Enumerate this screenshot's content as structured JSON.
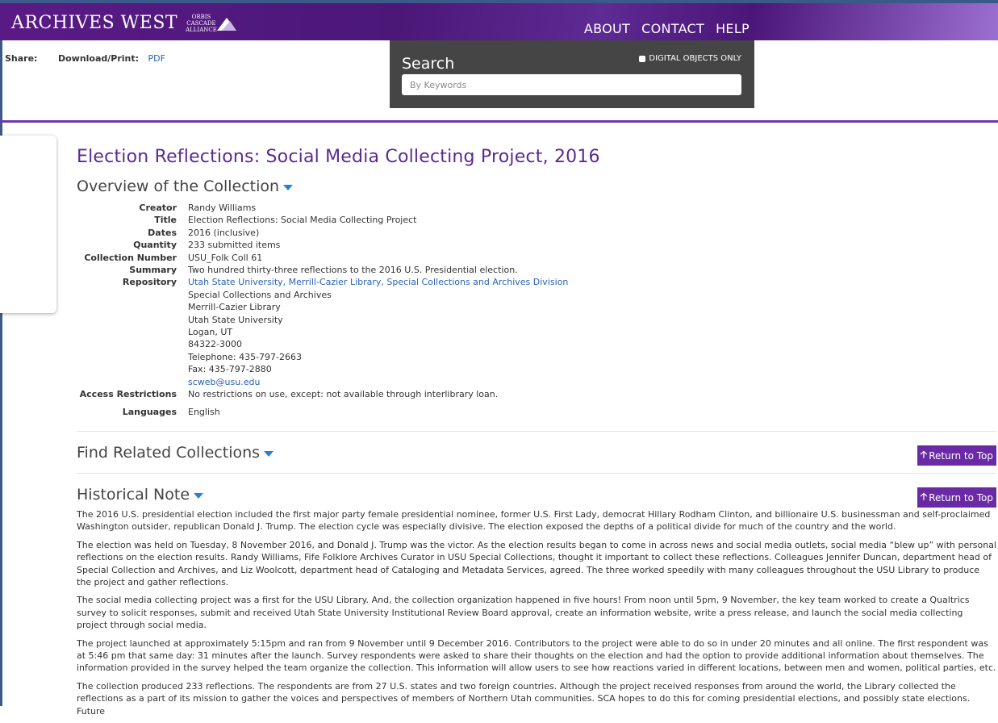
{
  "header": {
    "logo": "ARCHIVES WEST",
    "partner_logo_lines": [
      "ORBIS",
      "CASCADE",
      "ALLIANCE"
    ],
    "nav": [
      "ABOUT",
      "CONTACT",
      "HELP"
    ]
  },
  "share": {
    "share_label": "Share:",
    "download_label": "Download/Print:",
    "pdf_link": "PDF"
  },
  "search": {
    "title": "Search",
    "digital_only_label": "DIGITAL OBJECTS ONLY",
    "placeholder": "By Keywords"
  },
  "page_title": "Election Reflections: Social Media Collecting Project, 2016",
  "overview": {
    "heading": "Overview of the Collection",
    "rows": [
      {
        "key": "Creator",
        "value": "Randy Williams"
      },
      {
        "key": "Title",
        "value": "Election Reflections: Social Media Collecting Project"
      },
      {
        "key": "Dates",
        "value": "2016 (inclusive)"
      },
      {
        "key": "Quantity",
        "value": "233 submitted items"
      },
      {
        "key": "Collection Number",
        "value": "USU_Folk Coll 61"
      },
      {
        "key": "Summary",
        "value": "Two hundred thirty-three reflections to the 2016 U.S. Presidential election."
      }
    ],
    "repository_key": "Repository",
    "repository_link": "Utah State University, Merrill-Cazier Library, Special Collections and Archives Division",
    "repository_lines": [
      "Special Collections and Archives",
      "Merrill-Cazier Library",
      "Utah State University",
      "Logan, UT",
      "84322-3000",
      "Telephone: 435-797-2663",
      "Fax: 435-797-2880"
    ],
    "repository_email": "scweb@usu.edu",
    "access_key": "Access Restrictions",
    "access_value": "No restrictions on use, except: not available through interlibrary loan.",
    "languages_key": "Languages",
    "languages_value": "English"
  },
  "related": {
    "heading": "Find Related Collections",
    "return_label": "Return to Top"
  },
  "historical": {
    "heading": "Historical Note",
    "return_label": "Return to Top",
    "paragraphs": [
      "The 2016 U.S. presidential election included the first major party female presidential nominee, former U.S. First Lady, democrat Hillary Rodham Clinton, and billionaire U.S. businessman and self-proclaimed Washington outsider, republican Donald J. Trump. The election cycle was especially divisive. The election exposed the depths of a political divide for much of the country and the world.",
      "The election was held on Tuesday, 8 November 2016, and Donald J. Trump was the victor. As the election results began to come in across news and social media outlets, social media “blew up” with personal reflections on the election results. Randy Williams, Fife Folklore Archives Curator in USU Special Collections, thought it important to collect these reflections. Colleagues Jennifer Duncan, department head of Special Collection and Archives, and Liz Woolcott, department head of Cataloging and Metadata Services, agreed. The three worked speedily with many colleagues throughout the USU Library to produce the project and gather reflections.",
      "The social media collecting project was a first for the USU Library. And, the collection organization happened in five hours! From noon until 5pm, 9 November, the key team worked to create a Qualtrics survey to solicit responses, submit and received Utah State University Institutional Review Board approval, create an information website, write a press release, and launch the social media collecting project through social media.",
      "The project launched at approximately 5:15pm and ran from 9 November until 9 December 2016. Contributors to the project were able to do so in under 20 minutes and all online. The first respondent was at 5:46 pm that same day: 31 minutes after the launch. Survey respondents were asked to share their thoughts on the election and had the option to provide additional information about themselves. The information provided in the survey helped the team organize the collection. This information will allow users to see how reactions varied in different locations, between men and women, political parties, etc.",
      "The collection produced 233 reflections. The respondents are from 27 U.S. states and two foreign countries. Although the project received responses from around the world, the Library collected the reflections as a part of its mission to gather the voices and perspectives of members of Northern Utah communities. SCA hopes to do this for coming presidential elections, and possibly state elections. Future"
    ]
  },
  "colors": {
    "brand_purple": "#5a2a93",
    "header_purple": "#4b1878",
    "link_blue": "#2a62b5",
    "return_button": "#6a2aa5",
    "search_panel": "#454545"
  }
}
